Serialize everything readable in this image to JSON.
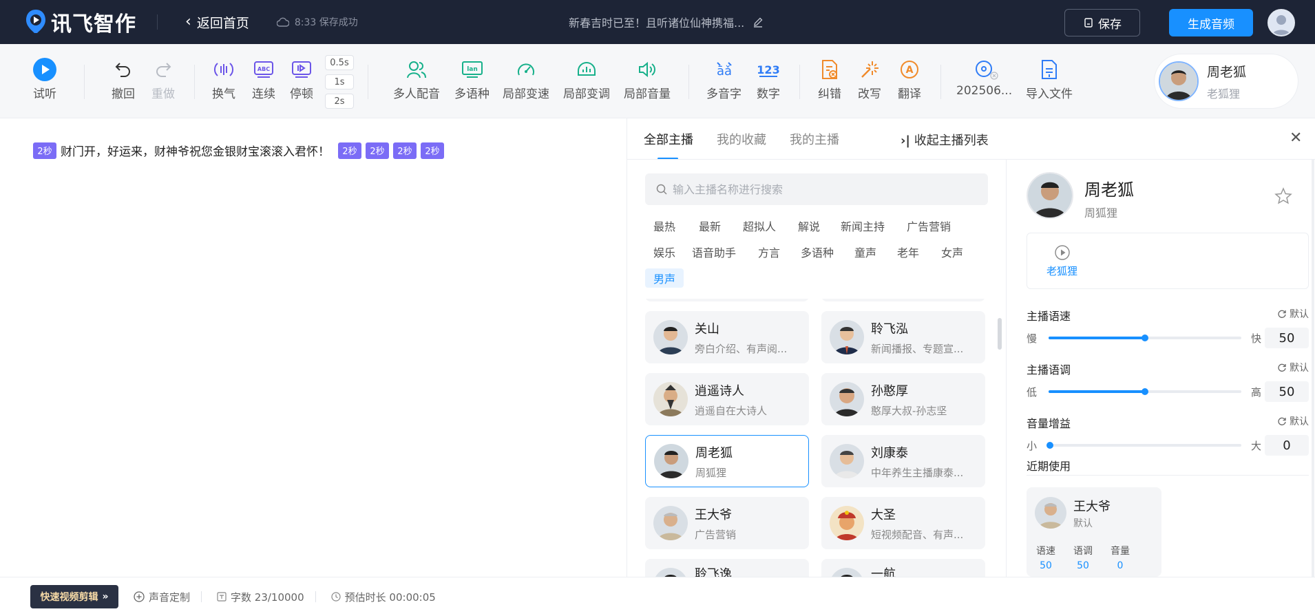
{
  "app": {
    "logo_text": "讯飞智作",
    "back_label": "返回首页",
    "save_status": "8:33 保存成功",
    "doc_title": "新春吉时已至！且听诸位仙神携福...",
    "save_button": "保存",
    "generate_button": "生成音频"
  },
  "toolbar": {
    "listen": "试听",
    "undo": "撤回",
    "redo": "重做",
    "breath": "换气",
    "continuous": "连续",
    "pause": "停顿",
    "pause_options": [
      "0.5s",
      "1s",
      "2s"
    ],
    "multi_voice": "多人配音",
    "multi_language": "多语种",
    "local_speed": "局部变速",
    "local_pitch": "局部变调",
    "local_volume": "局部音量",
    "polyphone": "多音字",
    "number": "数字",
    "correct": "纠错",
    "rewrite": "改写",
    "translate": "翻译",
    "audio_file": "202506...",
    "import_file": "导入文件",
    "current_anchor": {
      "name": "周老狐",
      "style": "老狐狸"
    }
  },
  "editor": {
    "pause_tag": "2秒",
    "text": "财门开，好运来，财神爷祝您金银财宝滚滚入君怀！"
  },
  "statusbar": {
    "quick_video": "快速视频剪辑",
    "voice_custom": "声音定制",
    "word_count": "字数 23/10000",
    "duration": "预估时长 00:00:05"
  },
  "panel": {
    "tabs": [
      "全部主播",
      "我的收藏",
      "我的主播"
    ],
    "collapse": "收起主播列表",
    "search_placeholder": "输入主播名称进行搜索",
    "categories": [
      "最热",
      "最新",
      "超拟人",
      "解说",
      "新闻主持",
      "广告营销",
      "娱乐",
      "语音助手",
      "方言",
      "多语种",
      "童声",
      "老年",
      "女声",
      "男声"
    ],
    "active_category": "男声",
    "anchors": [
      {
        "name": "关山",
        "desc": "旁白介绍、有声阅..."
      },
      {
        "name": "聆飞泓",
        "desc": "新闻播报、专题宣..."
      },
      {
        "name": "逍遥诗人",
        "desc": "逍遥自在大诗人"
      },
      {
        "name": "孙憨厚",
        "desc": "憨厚大叔-孙志坚"
      },
      {
        "name": "周老狐",
        "desc": "周狐狸"
      },
      {
        "name": "刘康泰",
        "desc": "中年养生主播康泰..."
      },
      {
        "name": "王大爷",
        "desc": "广告营销"
      },
      {
        "name": "大圣",
        "desc": "短视频配音、有声..."
      },
      {
        "name": "聆飞逸",
        "desc": ""
      },
      {
        "name": "一航",
        "desc": ""
      }
    ],
    "selected_anchor": "周老狐"
  },
  "detail": {
    "name": "周老狐",
    "sub": "周狐狸",
    "style_label": "老狐狸",
    "speed": {
      "title": "主播语速",
      "reset": "默认",
      "low": "慢",
      "high": "快",
      "value": "50"
    },
    "pitch": {
      "title": "主播语调",
      "reset": "默认",
      "low": "低",
      "high": "高",
      "value": "50"
    },
    "volume": {
      "title": "音量增益",
      "reset": "默认",
      "low": "小",
      "high": "大",
      "value": "0"
    },
    "recent_title": "近期使用",
    "recent": {
      "name": "王大爷",
      "style": "默认",
      "speed_label": "语速",
      "speed": "50",
      "pitch_label": "语调",
      "pitch": "50",
      "volume_label": "音量",
      "volume": "0"
    }
  },
  "colors": {
    "topbar": "#1d2436",
    "accent": "#1890ff",
    "pause_tag": "#7b6cf6",
    "toolbar_green": "#16b08a",
    "toolbar_purple": "#6b55e8",
    "toolbar_blue": "#2f7cf6",
    "toolbar_orange": "#f08a2a"
  }
}
